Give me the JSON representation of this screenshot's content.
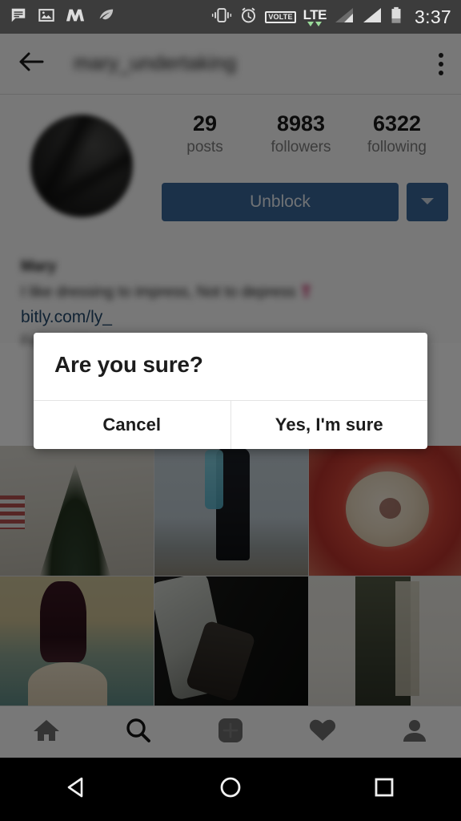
{
  "status_bar": {
    "time": "3:37",
    "left_icons": [
      "message-icon",
      "photo-icon",
      "m-logo-icon",
      "feather-icon"
    ],
    "right_icons": [
      "vibrate-icon",
      "alarm-icon",
      "volte-icon",
      "lte-icon",
      "signal-1-icon",
      "signal-2-icon",
      "battery-icon"
    ],
    "volte_label": "VOLTE",
    "lte_label": "LTE",
    "bg_color": "#3c3c3c"
  },
  "app_bar": {
    "back_icon": "back-arrow-icon",
    "username": "mary_undertaking",
    "overflow_icon": "overflow-menu-icon"
  },
  "profile": {
    "avatar_alt": "profile-photo",
    "stats": [
      {
        "number": "29",
        "label": "posts"
      },
      {
        "number": "8983",
        "label": "followers"
      },
      {
        "number": "6322",
        "label": "following"
      }
    ],
    "primary_action": "Unblock",
    "dropdown_icon": "chevron-down-icon",
    "button_color": "#3a6698",
    "bio_name": "Mary",
    "bio_text": "I like dressing to impress, Not to depress",
    "bio_emoji": "❣",
    "bio_link": "bitly.com/ly_",
    "bio_link_color": "#24496d",
    "bio_follow": "Followed by"
  },
  "grid": {
    "tiles": [
      {
        "name": "post-christmas-tree"
      },
      {
        "name": "post-outfit-boardwalk"
      },
      {
        "name": "post-red-flower"
      },
      {
        "name": "post-beach-woman"
      },
      {
        "name": "post-dark-jeans-boots"
      },
      {
        "name": "post-olive-outfit"
      }
    ]
  },
  "tab_bar": {
    "items": [
      {
        "icon": "home-icon",
        "active": false
      },
      {
        "icon": "search-icon",
        "active": true
      },
      {
        "icon": "add-post-icon",
        "active": false
      },
      {
        "icon": "heart-icon",
        "active": false
      },
      {
        "icon": "profile-icon",
        "active": false
      }
    ]
  },
  "dialog": {
    "title": "Are you sure?",
    "cancel_label": "Cancel",
    "confirm_label": "Yes, I'm sure"
  },
  "android_nav": {
    "back_label": "back-triangle-icon",
    "home_label": "home-circle-icon",
    "recents_label": "recents-square-icon"
  }
}
